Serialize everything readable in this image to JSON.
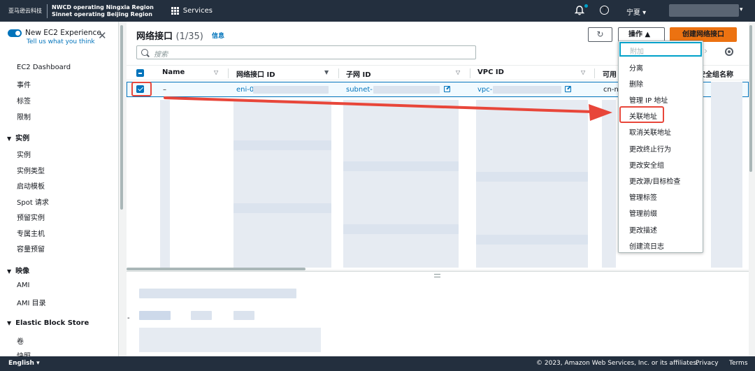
{
  "topnav": {
    "logo_text": "亚马逊云科技",
    "region_line1": "NWCD operating Ningxia Region",
    "region_line2": "Sinnet operating Beijing Region",
    "services_label": "Services",
    "region_selector": "宁夏 ▾",
    "help_label": "?"
  },
  "sidebar": {
    "new_experience_label": "New EC2 Experience",
    "new_experience_sub": "Tell us what you think",
    "close_label": "✕",
    "items": [
      {
        "label": "EC2 Dashboard"
      },
      {
        "label": "事件"
      },
      {
        "label": "标签"
      },
      {
        "label": "限制"
      }
    ],
    "sections": [
      {
        "label": "实例",
        "items": [
          "实例",
          "实例类型",
          "启动模板",
          "Spot 请求",
          "预留实例",
          "专属主机",
          "容量预留"
        ]
      },
      {
        "label": "映像",
        "items": [
          "AMI",
          "AMI 目录"
        ]
      },
      {
        "label": "Elastic Block Store",
        "items": [
          "卷",
          "快照"
        ]
      }
    ]
  },
  "panel": {
    "title": "网络接口",
    "count": "(1/35)",
    "info_link": "信息",
    "refresh_icon": "↻",
    "actions_label": "操作 ▲",
    "create_label": "创建网络接口",
    "search_placeholder": "搜索",
    "pager_next": "›"
  },
  "table": {
    "columns": [
      "Name",
      "网络接口 ID",
      "子网 ID",
      "VPC ID",
      "可用",
      "安全组名称"
    ],
    "selected_row": {
      "name": "–",
      "eni": "eni-0",
      "subnet": "subnet-",
      "vpc": "vpc-",
      "az": "cn-n"
    }
  },
  "actions_menu": {
    "items": [
      "附加",
      "分离",
      "删除",
      "管理 IP 地址",
      "关联地址",
      "取消关联地址",
      "更改终止行为",
      "更改安全组",
      "更改源/目标检查",
      "管理标签",
      "管理前缀",
      "更改描述",
      "创建流日志"
    ],
    "disabled_item": "附加",
    "highlighted_item": "关联地址"
  },
  "lower_panel": {
    "dash": "-"
  },
  "footer": {
    "language": "English ▾",
    "copyright": "© 2023, Amazon Web Services, Inc. or its affiliates.",
    "privacy": "Privacy",
    "terms": "Terms"
  },
  "colors": {
    "nav_bg": "#232f3e",
    "accent": "#0073bb",
    "primary_button": "#ec7211",
    "annotation_red": "#e8463a"
  }
}
